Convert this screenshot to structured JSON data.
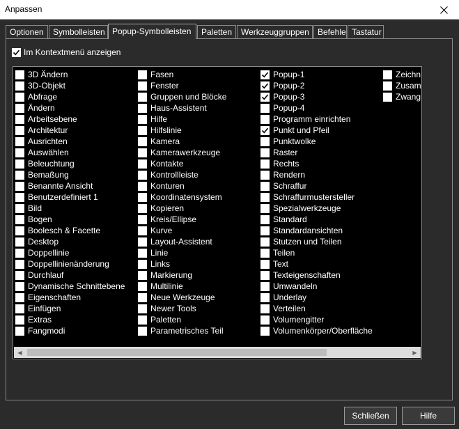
{
  "window": {
    "title": "Anpassen"
  },
  "tabs": [
    {
      "label": "Optionen",
      "active": false
    },
    {
      "label": "Symbolleisten",
      "active": false
    },
    {
      "label": "Popup-Symbolleisten",
      "active": true
    },
    {
      "label": "Paletten",
      "active": false
    },
    {
      "label": "Werkzeuggruppen",
      "active": false
    },
    {
      "label": "Befehle",
      "active": false
    },
    {
      "label": "Tastatur",
      "active": false
    }
  ],
  "context_menu": {
    "label": "Im Kontextmenü anzeigen",
    "checked": true
  },
  "columns": [
    [
      {
        "label": "3D Ändern",
        "checked": false
      },
      {
        "label": "3D-Objekt",
        "checked": false
      },
      {
        "label": "Abfrage",
        "checked": false
      },
      {
        "label": "Ändern",
        "checked": false
      },
      {
        "label": "Arbeitsebene",
        "checked": false
      },
      {
        "label": "Architektur",
        "checked": false
      },
      {
        "label": "Ausrichten",
        "checked": false
      },
      {
        "label": "Auswählen",
        "checked": false
      },
      {
        "label": "Beleuchtung",
        "checked": false
      },
      {
        "label": "Bemaßung",
        "checked": false
      },
      {
        "label": "Benannte Ansicht",
        "checked": false
      },
      {
        "label": "Benutzerdefiniert 1",
        "checked": false
      },
      {
        "label": "Bild",
        "checked": false
      },
      {
        "label": "Bogen",
        "checked": false
      },
      {
        "label": "Boolesch & Facette",
        "checked": false
      },
      {
        "label": "Desktop",
        "checked": false
      },
      {
        "label": "Doppellinie",
        "checked": false
      },
      {
        "label": "Doppellinienänderung",
        "checked": false
      },
      {
        "label": "Durchlauf",
        "checked": false
      },
      {
        "label": "Dynamische Schnittebene",
        "checked": false
      },
      {
        "label": "Eigenschaften",
        "checked": false
      },
      {
        "label": "Einfügen",
        "checked": false
      },
      {
        "label": "Extras",
        "checked": false
      },
      {
        "label": "Fangmodi",
        "checked": false
      }
    ],
    [
      {
        "label": "Fasen",
        "checked": false
      },
      {
        "label": "Fenster",
        "checked": false
      },
      {
        "label": "Gruppen und Blöcke",
        "checked": false
      },
      {
        "label": "Haus-Assistent",
        "checked": false
      },
      {
        "label": "Hilfe",
        "checked": false
      },
      {
        "label": "Hilfslinie",
        "checked": false
      },
      {
        "label": "Kamera",
        "checked": false
      },
      {
        "label": "Kamerawerkzeuge",
        "checked": false
      },
      {
        "label": "Kontakte",
        "checked": false
      },
      {
        "label": "Kontrollleiste",
        "checked": false
      },
      {
        "label": "Konturen",
        "checked": false
      },
      {
        "label": "Koordinatensystem",
        "checked": false
      },
      {
        "label": "Kopieren",
        "checked": false
      },
      {
        "label": "Kreis/Ellipse",
        "checked": false
      },
      {
        "label": "Kurve",
        "checked": false
      },
      {
        "label": "Layout-Assistent",
        "checked": false
      },
      {
        "label": "Linie",
        "checked": false
      },
      {
        "label": "Links",
        "checked": false
      },
      {
        "label": "Markierung",
        "checked": false
      },
      {
        "label": "Multilinie",
        "checked": false
      },
      {
        "label": "Neue Werkzeuge",
        "checked": false
      },
      {
        "label": "Newer Tools",
        "checked": false
      },
      {
        "label": "Paletten",
        "checked": false
      },
      {
        "label": "Parametrisches Teil",
        "checked": false
      }
    ],
    [
      {
        "label": "Popup-1",
        "checked": true
      },
      {
        "label": "Popup-2",
        "checked": true
      },
      {
        "label": "Popup-3",
        "checked": true
      },
      {
        "label": "Popup-4",
        "checked": false
      },
      {
        "label": "Programm einrichten",
        "checked": false
      },
      {
        "label": "Punkt und Pfeil",
        "checked": true
      },
      {
        "label": "Punktwolke",
        "checked": false
      },
      {
        "label": "Raster",
        "checked": false
      },
      {
        "label": "Rechts",
        "checked": false
      },
      {
        "label": "Rendern",
        "checked": false
      },
      {
        "label": "Schraffur",
        "checked": false
      },
      {
        "label": "Schraffurmustersteller",
        "checked": false
      },
      {
        "label": "Spezialwerkzeuge",
        "checked": false
      },
      {
        "label": "Standard",
        "checked": false
      },
      {
        "label": "Standardansichten",
        "checked": false
      },
      {
        "label": "Stutzen und Teilen",
        "checked": false
      },
      {
        "label": "Teilen",
        "checked": false
      },
      {
        "label": "Text",
        "checked": false
      },
      {
        "label": "Texteigenschaften",
        "checked": false
      },
      {
        "label": "Umwandeln",
        "checked": false
      },
      {
        "label": "Underlay",
        "checked": false
      },
      {
        "label": "Verteilen",
        "checked": false
      },
      {
        "label": "Volumengitter",
        "checked": false
      },
      {
        "label": "Volumenkörper/Oberfläche",
        "checked": false
      }
    ],
    [
      {
        "label": "Zeichn",
        "checked": false
      },
      {
        "label": "Zusam",
        "checked": false
      },
      {
        "label": "Zwang",
        "checked": false
      }
    ]
  ],
  "buttons": {
    "close": "Schließen",
    "help": "Hilfe"
  },
  "colors": {
    "background": "#2b2b2b",
    "list_background": "#000000",
    "text": "#ffffff"
  }
}
